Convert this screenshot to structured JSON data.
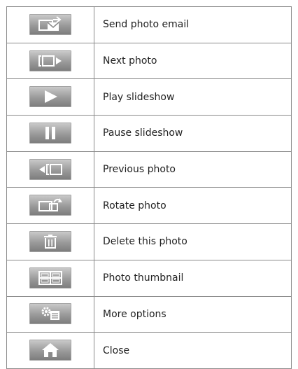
{
  "legend": {
    "rows": [
      {
        "icon": "send-photo-email-icon",
        "label": "Send photo email"
      },
      {
        "icon": "next-photo-icon",
        "label": "Next photo"
      },
      {
        "icon": "play-icon",
        "label": "Play slideshow"
      },
      {
        "icon": "pause-icon",
        "label": "Pause slideshow"
      },
      {
        "icon": "previous-photo-icon",
        "label": "Previous photo"
      },
      {
        "icon": "rotate-photo-icon",
        "label": "Rotate photo"
      },
      {
        "icon": "trash-icon",
        "label": "Delete this photo"
      },
      {
        "icon": "thumbnail-grid-icon",
        "label": "Photo thumbnail"
      },
      {
        "icon": "more-options-icon",
        "label": "More options"
      },
      {
        "icon": "home-icon",
        "label": "Close"
      }
    ]
  }
}
